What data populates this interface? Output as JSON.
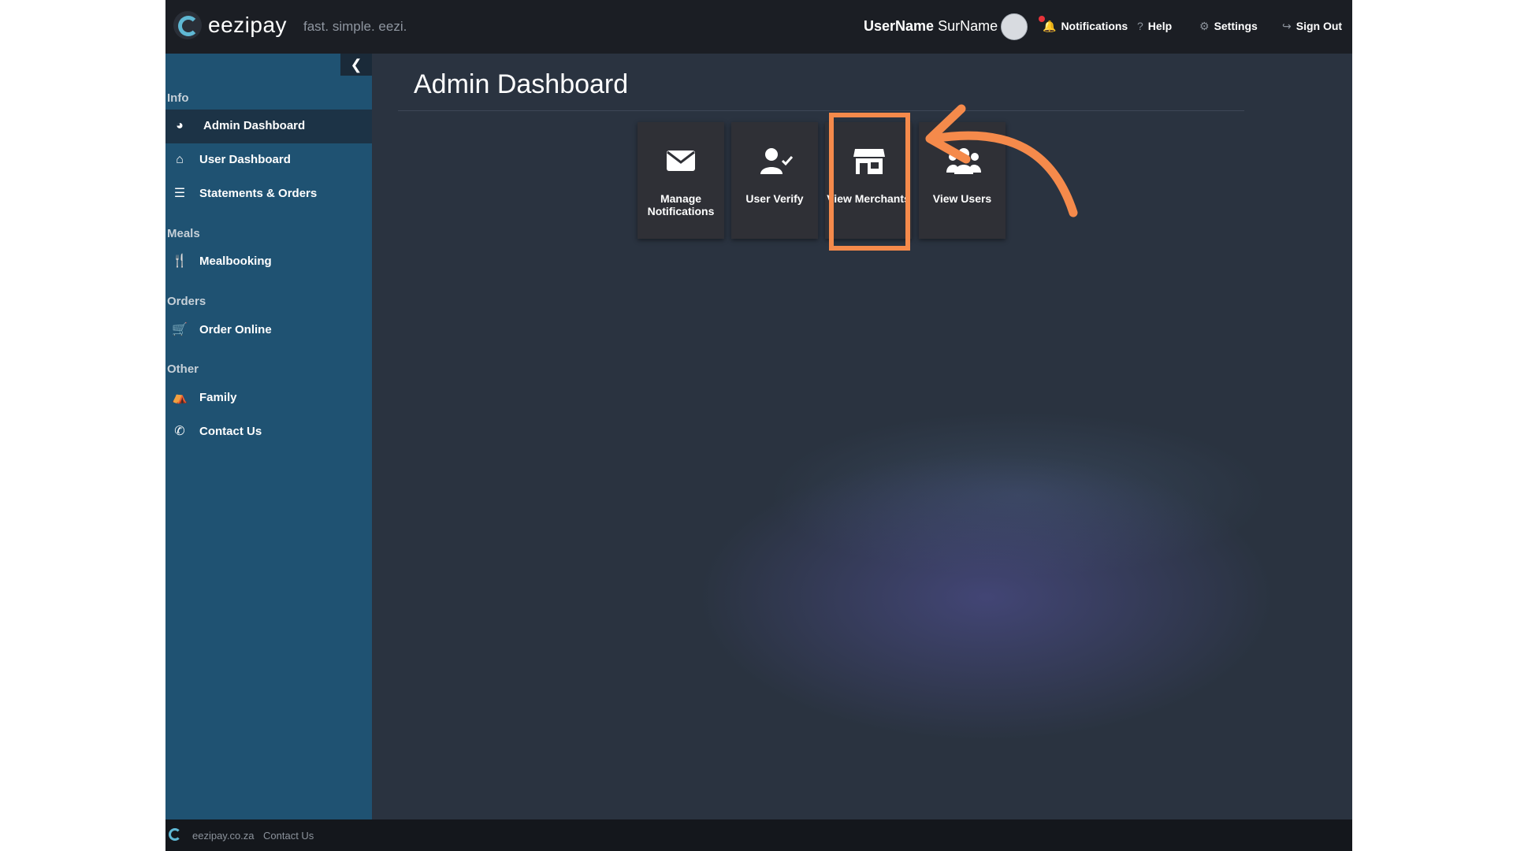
{
  "topbar": {
    "brand": "eezipay",
    "tagline": "fast. simple. eezi.",
    "user_first": "UserName",
    "user_last": "SurName",
    "nav": [
      {
        "label": "Notifications",
        "icon": "bell-icon"
      },
      {
        "label": "Help",
        "icon": "question-icon"
      },
      {
        "label": "Settings",
        "icon": "gear-icon"
      },
      {
        "label": "Sign Out",
        "icon": "sign-out-icon"
      }
    ]
  },
  "sidebar": {
    "collapse_icon": "chevron-left-icon",
    "sections": [
      {
        "heading": "Info",
        "items": [
          {
            "label": "Admin Dashboard",
            "icon": "dashboard-icon",
            "active": true
          },
          {
            "label": "User Dashboard",
            "icon": "home-icon"
          },
          {
            "label": "Statements & Orders",
            "icon": "list-icon"
          }
        ]
      },
      {
        "heading": "Meals",
        "items": [
          {
            "label": "Mealbooking",
            "icon": "cutlery-icon"
          }
        ]
      },
      {
        "heading": "Orders",
        "items": [
          {
            "label": "Order Online",
            "icon": "basket-icon"
          }
        ]
      },
      {
        "heading": "Other",
        "items": [
          {
            "label": "Family",
            "icon": "family-icon"
          },
          {
            "label": "Contact Us",
            "icon": "phone-icon"
          }
        ]
      }
    ]
  },
  "main": {
    "title": "Admin Dashboard",
    "tiles": [
      {
        "label": "Manage Notifications",
        "icon": "envelope-icon"
      },
      {
        "label": "User Verify",
        "icon": "user-check-icon"
      },
      {
        "label": "View Merchants",
        "icon": "store-icon",
        "highlighted": true
      },
      {
        "label": "View Users",
        "icon": "users-icon"
      }
    ]
  },
  "footer": {
    "site": "eezipay.co.za",
    "contact": "Contact Us"
  },
  "colors": {
    "topbar": "#1b1e24",
    "sidebar": "#1f5272",
    "main_bg": "#2a3340",
    "highlight": "#f58a4b"
  }
}
